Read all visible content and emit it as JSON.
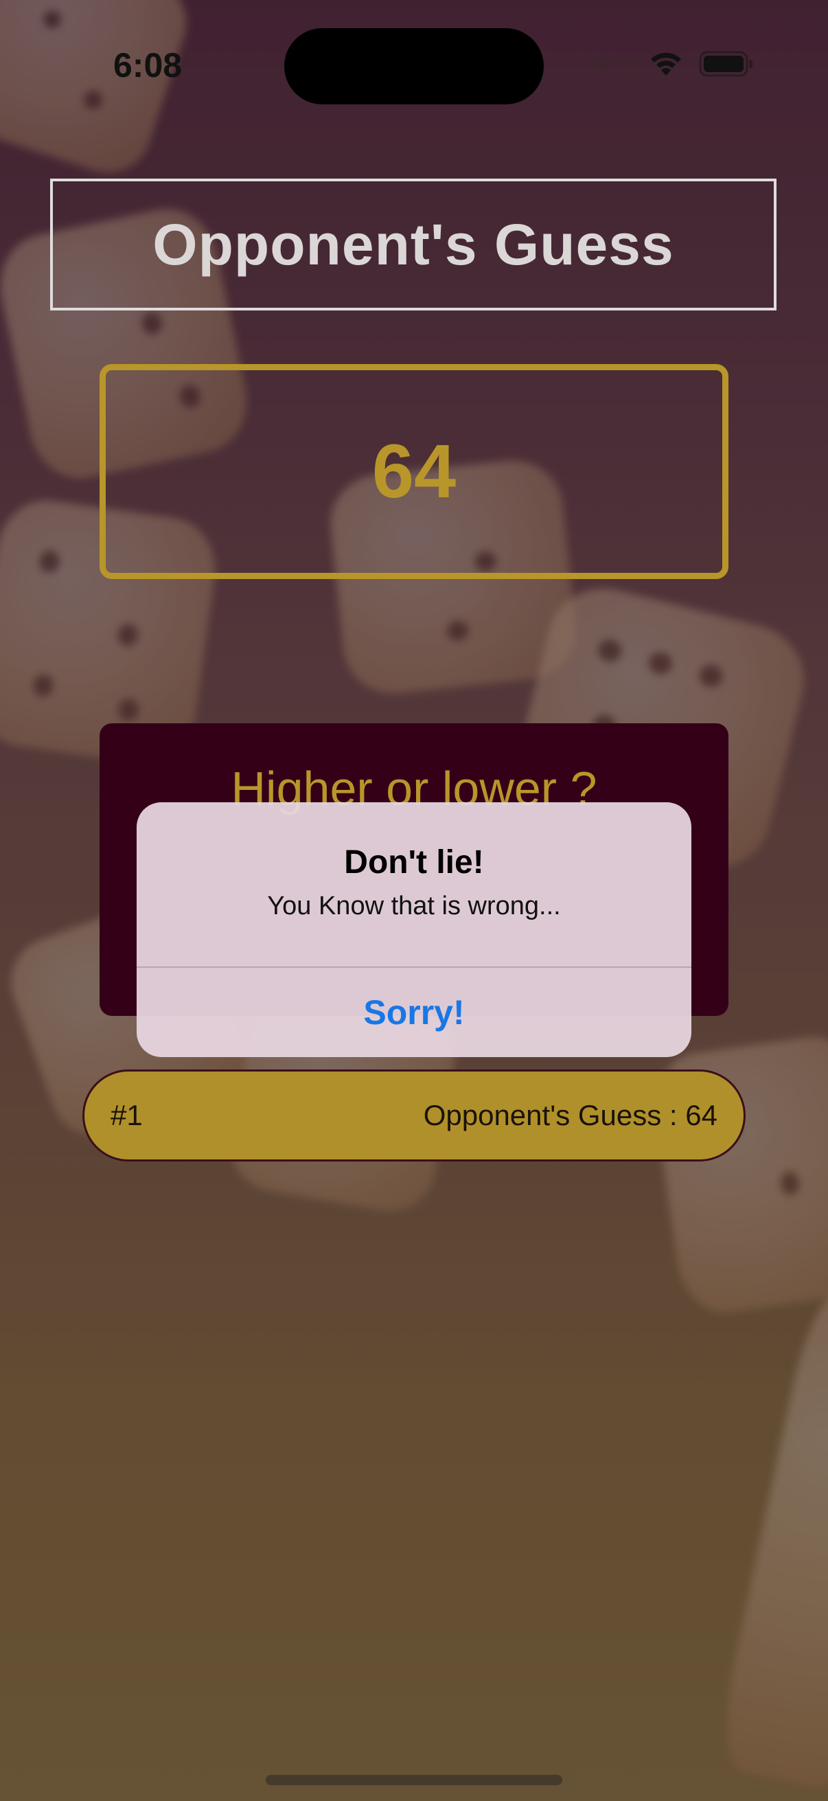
{
  "status_bar": {
    "time": "6:08"
  },
  "screen": {
    "title": "Opponent's Guess",
    "current_guess": "64",
    "prompt": "Higher or lower ?"
  },
  "history": [
    {
      "index": "#1",
      "label": "Opponent's Guess : 64"
    }
  ],
  "alert": {
    "title": "Don't lie!",
    "message": "You Know that is wrong...",
    "button_label": "Sorry!"
  },
  "colors": {
    "accent": "#b8962a",
    "card": "#340018",
    "alert_button": "#1877e6"
  }
}
